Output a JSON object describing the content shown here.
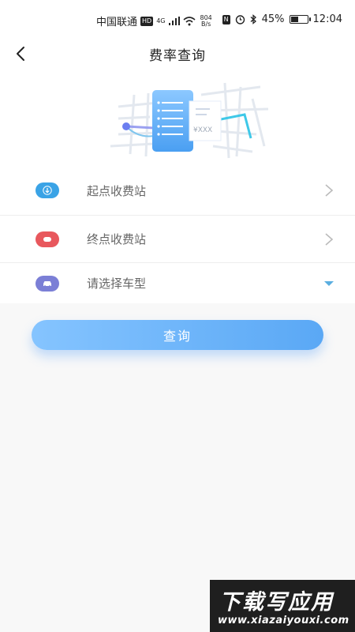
{
  "status_bar": {
    "carrier": "中国联通",
    "hd": "HD",
    "network": "4G",
    "speed_value": "804",
    "speed_unit": "B/s",
    "nfc": "N",
    "battery": "45%",
    "time": "12:04"
  },
  "header": {
    "title": "费率查询",
    "back_icon": "chevron-left-icon"
  },
  "hero": {
    "price_text": "¥XXX"
  },
  "form": {
    "rows": [
      {
        "label": "起点收费站",
        "icon": "download-arrow-icon",
        "color": "#3aa3e6"
      },
      {
        "label": "终点收费站",
        "icon": "stop-icon",
        "color": "#e8585d"
      },
      {
        "label": "请选择车型",
        "icon": "car-icon",
        "color": "#7b7fd6"
      }
    ]
  },
  "query_button": {
    "label": "查询"
  },
  "watermark": {
    "title": "下载写应用",
    "url": "www.xiazaiyouxi.com"
  },
  "colors": {
    "accent": "#5aa8f5",
    "caret": "#5aaee0"
  }
}
